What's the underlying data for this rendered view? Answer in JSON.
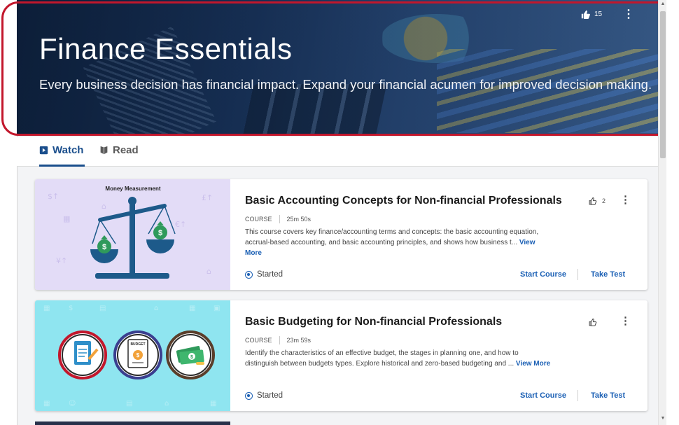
{
  "hero": {
    "title": "Finance Essentials",
    "subtitle": "Every business decision has financial impact. Expand your financial acumen for improved decision making.",
    "like_count": "15"
  },
  "tabs": [
    {
      "label": "Watch",
      "icon": "video-icon",
      "active": true
    },
    {
      "label": "Read",
      "icon": "book-icon",
      "active": false
    }
  ],
  "cards": [
    {
      "thumb_caption": "Money Measurement",
      "title": "Basic Accounting Concepts for Non-financial Professionals",
      "type": "COURSE",
      "duration": "25m 50s",
      "description": "This course covers key finance/accounting terms and concepts: the basic accounting equation, accrual-based accounting, and basic accounting principles, and shows how business t...",
      "view_more": "View More",
      "status": "Started",
      "start_label": "Start Course",
      "test_label": "Take Test",
      "like_count": "2"
    },
    {
      "thumb_caption": "",
      "badge_text": "BUDGET",
      "title": "Basic Budgeting for Non-financial Professionals",
      "type": "COURSE",
      "duration": "23m 59s",
      "description": "Identify the characteristics of an effective budget, the stages in planning one, and how to distinguish between budgets types. Explore historical and zero-based budgeting and ...",
      "view_more": "View More",
      "status": "Started",
      "start_label": "Start Course",
      "test_label": "Take Test",
      "like_count": ""
    }
  ],
  "colors": {
    "accent": "#1a5fb4",
    "highlight": "#c2172c",
    "thumb1_bg": "#e3dcf7",
    "thumb2_bg": "#8fe5f0"
  }
}
